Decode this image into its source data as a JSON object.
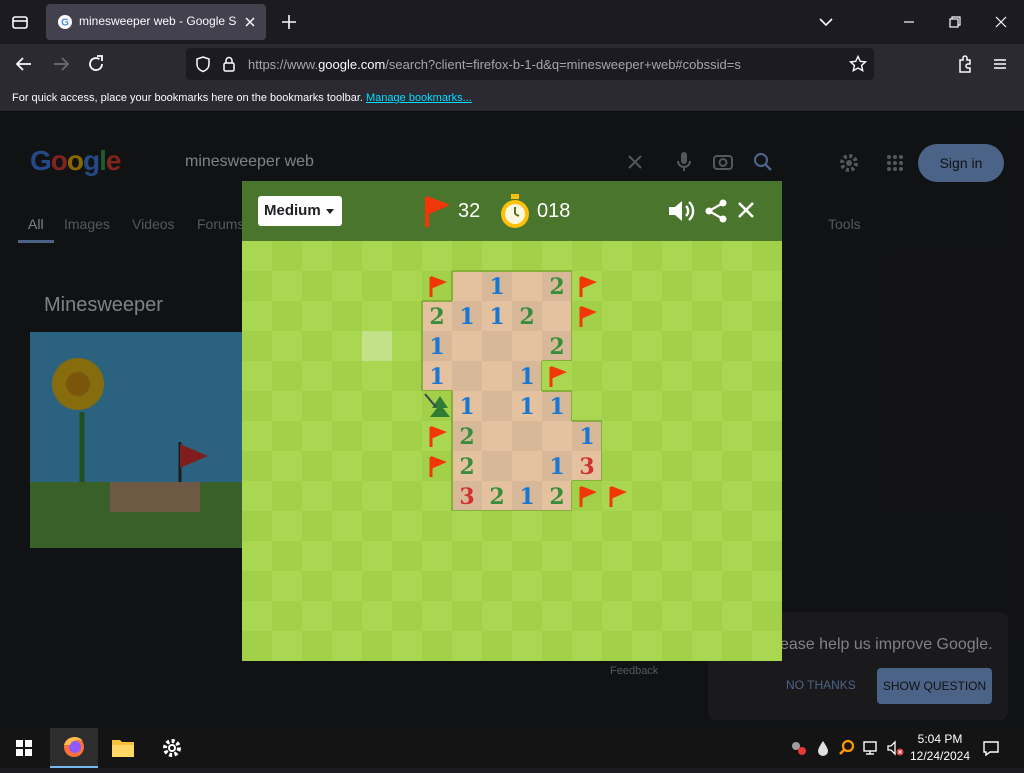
{
  "browser": {
    "tab_title": "minesweeper web - Google Sea",
    "url_prefix": "https://www.",
    "url_host": "google.com",
    "url_path": "/search?client=firefox-b-1-d&q=minesweeper+web#cobssid=s",
    "bookmarks_message": "For quick access, place your bookmarks here on the bookmarks toolbar.",
    "bookmarks_link": "Manage bookmarks..."
  },
  "google": {
    "logo": "Google",
    "query": "minesweeper web",
    "nav": [
      "All",
      "Images",
      "Videos",
      "Forums"
    ],
    "tools": "Tools",
    "signin": "Sign in",
    "heading": "Minesweeper",
    "feedback_text": "ease help us improve Google.",
    "feedback_no": "NO THANKS",
    "feedback_show": "SHOW QUESTION",
    "feedback_small": "Feedback"
  },
  "game": {
    "difficulty": "Medium",
    "flags_remaining": "32",
    "timer": "018",
    "colors": {
      "header": "#4a752c",
      "grass_light": "#aad751",
      "grass_dark": "#a2d149",
      "dirt_light": "#e5c29f",
      "dirt_dark": "#d7b899",
      "one": "#1976d2",
      "two": "#388e3c",
      "three": "#d32f2f",
      "flag": "#f23607"
    },
    "board": [
      "..........................",
      "......F*1*2F.........",
      "......2112*F..........",
      "......1***2...........",
      "......1**1F...........",
      "......T1*11...........",
      "......F2***1..........",
      "......F2**13..........",
      ".......3212FF.........",
      "..........................",
      "..........................",
      "..........................",
      "..........................",
      ".........................."
    ]
  },
  "taskbar": {
    "time": "5:04 PM",
    "date": "12/24/2024"
  }
}
